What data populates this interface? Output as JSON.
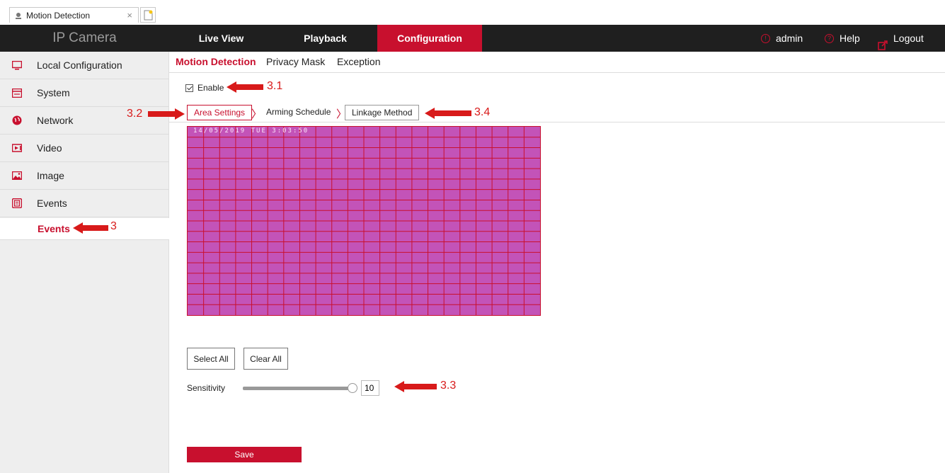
{
  "browser": {
    "tab_title": "Motion Detection",
    "close_glyph": "×"
  },
  "header": {
    "brand": "IP Camera",
    "nav": [
      {
        "label": "Live View"
      },
      {
        "label": "Playback"
      },
      {
        "label": "Configuration",
        "active": true
      }
    ],
    "user": "admin",
    "help": "Help",
    "logout": "Logout"
  },
  "sidebar": {
    "items": [
      {
        "label": "Local Configuration",
        "icon": "monitor-icon"
      },
      {
        "label": "System",
        "icon": "system-icon"
      },
      {
        "label": "Network",
        "icon": "globe-icon"
      },
      {
        "label": "Video",
        "icon": "video-icon"
      },
      {
        "label": "Image",
        "icon": "image-icon"
      },
      {
        "label": "Events",
        "icon": "events-icon"
      }
    ],
    "sub_item": "Events"
  },
  "subtabs": [
    {
      "label": "Motion Detection",
      "active": true
    },
    {
      "label": "Privacy Mask"
    },
    {
      "label": "Exception"
    }
  ],
  "enable": {
    "label": "Enable",
    "checked": true
  },
  "steps": [
    {
      "label": "Area Settings",
      "active": true
    },
    {
      "label": "Arming Schedule"
    },
    {
      "label": "Linkage Method"
    }
  ],
  "video": {
    "osd_text": "14/05/2019 TUE 3:03:50",
    "fill_color": "#c353b8",
    "grid_color": "#c8102e",
    "cols": 22,
    "rows": 18
  },
  "buttons": {
    "select_all": "Select All",
    "clear_all": "Clear All",
    "save": "Save"
  },
  "sensitivity": {
    "label": "Sensitivity",
    "value": "10",
    "level_fraction": 1.0
  },
  "annotations": {
    "a3": "3",
    "a31": "3.1",
    "a32": "3.2",
    "a33": "3.3",
    "a34": "3.4"
  },
  "colors": {
    "accent": "#c8102e",
    "annotation": "#d81a1a",
    "nav_bg": "#1f1f1f",
    "sidebar_bg": "#eeeeee"
  }
}
